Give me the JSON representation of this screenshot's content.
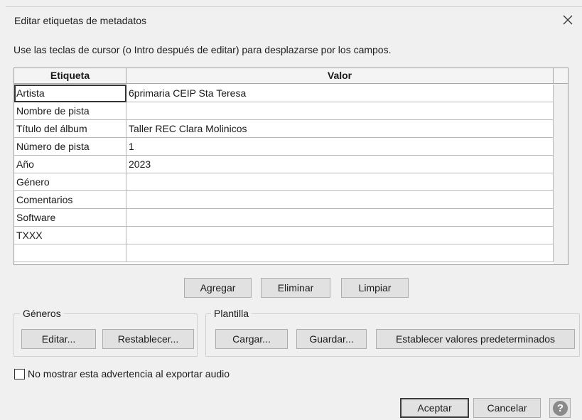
{
  "window": {
    "title": "Editar etiquetas de metadatos",
    "hint": "Use las teclas de cursor (o Intro después de editar) para desplazarse por los campos."
  },
  "grid": {
    "columns": [
      "Etiqueta",
      "Valor"
    ],
    "rows": [
      {
        "tag": "Artista",
        "value": "6primaria CEIP Sta Teresa"
      },
      {
        "tag": "Nombre de pista",
        "value": ""
      },
      {
        "tag": "Título del álbum",
        "value": "Taller REC Clara Molinicos"
      },
      {
        "tag": "Número de pista",
        "value": "1"
      },
      {
        "tag": "Año",
        "value": "2023"
      },
      {
        "tag": "Género",
        "value": ""
      },
      {
        "tag": "Comentarios",
        "value": ""
      },
      {
        "tag": "Software",
        "value": ""
      },
      {
        "tag": "TXXX",
        "value": ""
      },
      {
        "tag": "",
        "value": ""
      }
    ]
  },
  "row_actions": {
    "add": "Agregar",
    "remove": "Eliminar",
    "clear": "Limpiar"
  },
  "genres": {
    "label": "Géneros",
    "edit": "Editar...",
    "reset": "Restablecer..."
  },
  "template": {
    "label": "Plantilla",
    "load": "Cargar...",
    "save": "Guardar...",
    "set_default": "Establecer valores predeterminados"
  },
  "dont_show": {
    "label": "No mostrar esta advertencia al exportar audio",
    "checked": false
  },
  "footer": {
    "ok": "Aceptar",
    "cancel": "Cancelar",
    "help": "?"
  }
}
